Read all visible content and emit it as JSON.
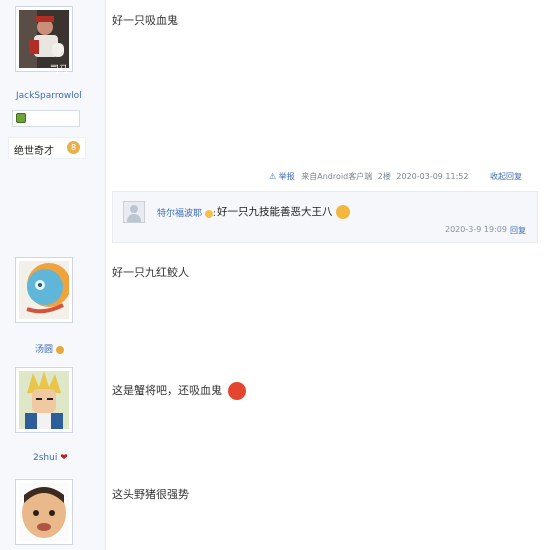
{
  "posts": [
    {
      "username": "JackSparrowlol",
      "avatar_caption": "司马",
      "title_badge": "绝世奇才",
      "level": "8",
      "content": "好一只吸血鬼",
      "meta": {
        "report": "举报",
        "source": "来自Android客户端",
        "floor": "2楼",
        "time": "2020-03-09 11:52",
        "reply_toggle": "收起回复"
      },
      "reply": {
        "user": "特尔福波耶",
        "text": "好一只九技能善恶大王八",
        "time": "2020-3-9 19:09",
        "reply_label": "回复"
      }
    },
    {
      "username": "汤圆",
      "content": "好一只九红鲛人"
    },
    {
      "username": "2shui",
      "content": "这是蟹将吧，还吸血鬼"
    },
    {
      "username": "",
      "content": "这头野猪很强势"
    }
  ],
  "colors": {
    "link": "#3d6cb6",
    "sidebar": "#f6f8fb",
    "meta": "#7c8694"
  }
}
